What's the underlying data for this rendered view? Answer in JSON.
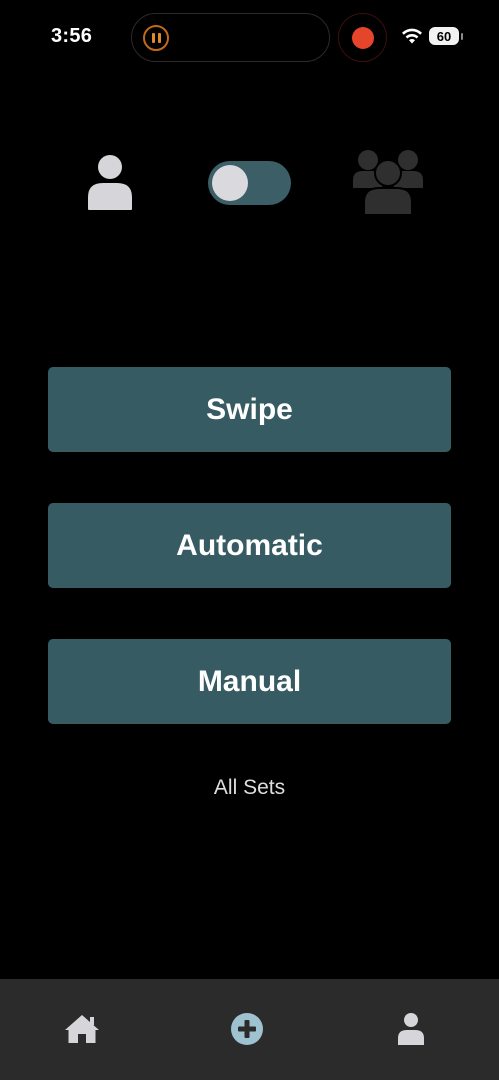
{
  "status_bar": {
    "time": "3:56",
    "battery_level": "60",
    "icons": [
      "pause-icon",
      "record-icon",
      "wifi-icon",
      "battery-icon"
    ]
  },
  "mode_selector": {
    "left_icon": "person-icon",
    "right_icon": "group-icon",
    "toggle_state": "off"
  },
  "buttons": {
    "swipe_label": "Swipe",
    "automatic_label": "Automatic",
    "manual_label": "Manual"
  },
  "links": {
    "all_sets_label": "All Sets"
  },
  "tab_bar": {
    "items": [
      "home-icon",
      "add-icon",
      "profile-icon"
    ]
  },
  "colors": {
    "background": "#000000",
    "button": "#365b63",
    "toggle_track": "#3c5f67",
    "tab_bar": "#2b2b2b",
    "record": "#e5452b",
    "add_icon": "#9ec2cf"
  }
}
